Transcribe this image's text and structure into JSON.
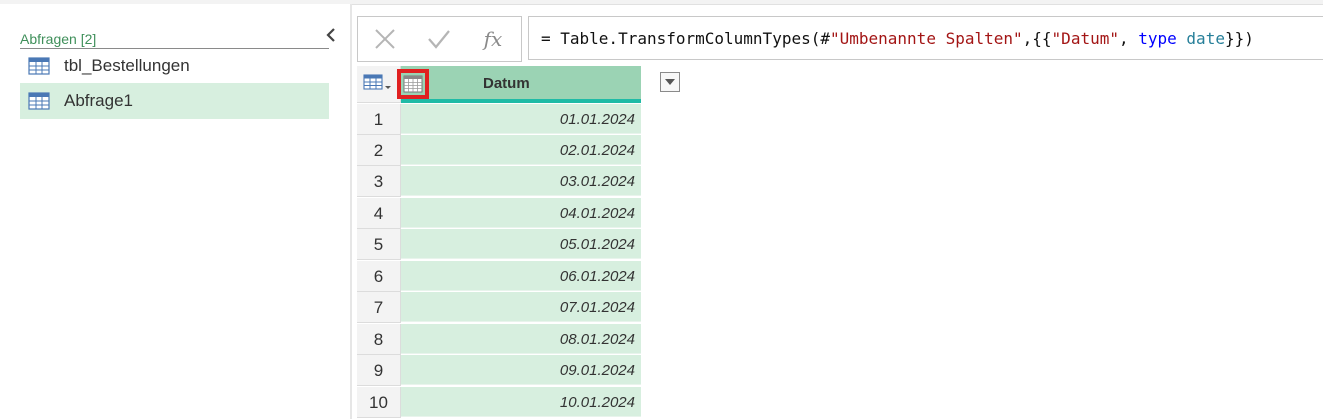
{
  "queries_pane": {
    "header": "Abfragen [2]",
    "items": [
      {
        "label": "tbl_Bestellungen",
        "selected": false
      },
      {
        "label": "Abfrage1",
        "selected": true
      }
    ]
  },
  "formula_bar": {
    "cancel_icon": "x-icon",
    "confirm_icon": "check-icon",
    "fx_label": "fx",
    "formula": {
      "prefix": "= Table.TransformColumnTypes(#",
      "string1": "\"Umbenannte Spalten\"",
      "middle": ",{{",
      "string2": "\"Datum\"",
      "sep": ", ",
      "keyword": "type",
      "space": " ",
      "type_name": "date",
      "suffix": "}})"
    }
  },
  "grid": {
    "column": {
      "title": "Datum",
      "type_icon": "calendar-icon"
    },
    "rows": [
      {
        "num": "1",
        "value": "01.01.2024"
      },
      {
        "num": "2",
        "value": "02.01.2024"
      },
      {
        "num": "3",
        "value": "03.01.2024"
      },
      {
        "num": "4",
        "value": "04.01.2024"
      },
      {
        "num": "5",
        "value": "05.01.2024"
      },
      {
        "num": "6",
        "value": "06.01.2024"
      },
      {
        "num": "7",
        "value": "07.01.2024"
      },
      {
        "num": "8",
        "value": "08.01.2024"
      },
      {
        "num": "9",
        "value": "09.01.2024"
      },
      {
        "num": "10",
        "value": "10.01.2024"
      }
    ]
  },
  "colors": {
    "accent_green": "#3f8f5a",
    "selected_bg": "#d7efdf",
    "column_header_bg": "#9bd3b4",
    "column_header_underline": "#1fbba6",
    "highlight_red": "#e02020"
  }
}
